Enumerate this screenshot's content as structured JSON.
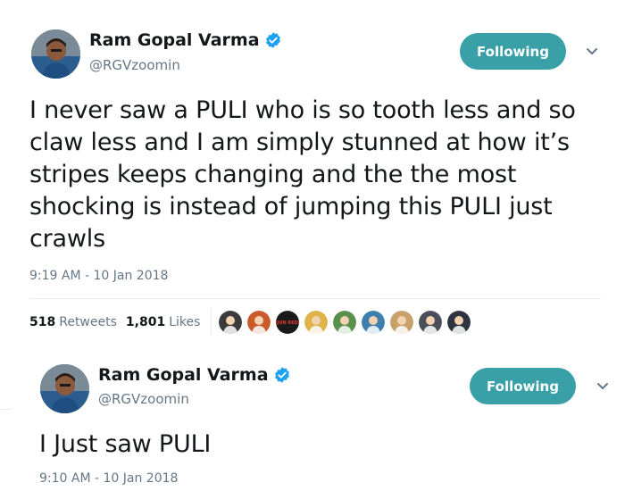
{
  "tweets": [
    {
      "author": {
        "name": "Ram Gopal Varma",
        "handle": "@RGVzoomin",
        "verified": true
      },
      "follow_label": "Following",
      "text": "I never saw a PULI who is so tooth less and so claw less and I am simply stunned at how it’s stripes keeps changing and the the most shocking is instead of jumping this PULI just crawls",
      "timestamp": "9:19 AM - 10 Jan 2018",
      "stats": {
        "retweets_count": "518",
        "retweets_label": "Retweets",
        "likes_count": "1,801",
        "likes_label": "Likes"
      },
      "likers": [
        {
          "icon": "liker-avatar-1",
          "color": "#3b3b3b",
          "text": ""
        },
        {
          "icon": "liker-avatar-2",
          "color": "#c95a2a",
          "text": ""
        },
        {
          "icon": "liker-avatar-3",
          "color": "#1a1a1a",
          "text": "ARJUN REDDY"
        },
        {
          "icon": "liker-avatar-4",
          "color": "#e0b24a",
          "text": ""
        },
        {
          "icon": "liker-avatar-5",
          "color": "#5a8f4e",
          "text": ""
        },
        {
          "icon": "liker-avatar-6",
          "color": "#3f7fae",
          "text": ""
        },
        {
          "icon": "liker-avatar-7",
          "color": "#c7a06a",
          "text": ""
        },
        {
          "icon": "liker-avatar-8",
          "color": "#4a4f5a",
          "text": ""
        },
        {
          "icon": "liker-avatar-9",
          "color": "#2f3540",
          "text": ""
        }
      ]
    },
    {
      "author": {
        "name": "Ram Gopal Varma",
        "handle": "@RGVzoomin",
        "verified": true
      },
      "follow_label": "Following",
      "text": "I Just saw PULI",
      "timestamp": "9:10 AM - 10 Jan 2018"
    }
  ],
  "colors": {
    "follow_button": "#3aa0a8",
    "verified_badge": "#1da1f2",
    "secondary_text": "#657786"
  }
}
